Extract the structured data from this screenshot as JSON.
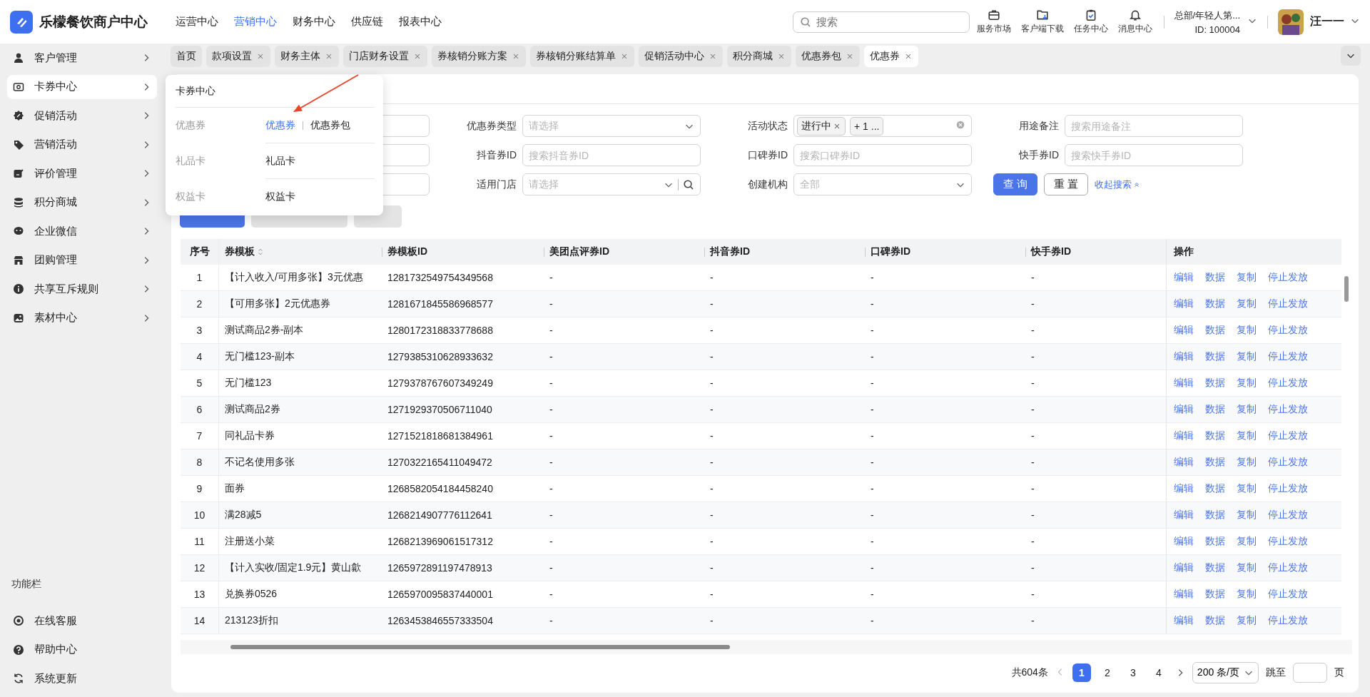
{
  "brand": {
    "name": "乐檬餐饮商户中心"
  },
  "top_nav": [
    {
      "label": "运营中心",
      "selected": false
    },
    {
      "label": "营销中心",
      "selected": true
    },
    {
      "label": "财务中心",
      "selected": false
    },
    {
      "label": "供应链",
      "selected": false
    },
    {
      "label": "报表中心",
      "selected": false
    }
  ],
  "search": {
    "placeholder": "搜索"
  },
  "header_tools": [
    {
      "label": "服务市场"
    },
    {
      "label": "客户端下载"
    },
    {
      "label": "任务中心"
    },
    {
      "label": "消息中心"
    }
  ],
  "org": {
    "name": "总部/年轻人第...",
    "id": "ID: 100004"
  },
  "user": {
    "name": "汪一一"
  },
  "sidebar": {
    "items": [
      {
        "label": "客户管理",
        "selected": false
      },
      {
        "label": "卡券中心",
        "selected": true
      },
      {
        "label": "促销活动",
        "selected": false
      },
      {
        "label": "营销活动",
        "selected": false
      },
      {
        "label": "评价管理",
        "selected": false
      },
      {
        "label": "积分商城",
        "selected": false
      },
      {
        "label": "企业微信",
        "selected": false
      },
      {
        "label": "团购管理",
        "selected": false
      },
      {
        "label": "共享互斥规则",
        "selected": false
      },
      {
        "label": "素材中心",
        "selected": false
      }
    ],
    "footer_title": "功能栏",
    "footer_items": [
      {
        "label": "在线客服"
      },
      {
        "label": "帮助中心"
      },
      {
        "label": "系统更新"
      }
    ]
  },
  "tabs": [
    {
      "label": "首页",
      "selected": false,
      "closable": false
    },
    {
      "label": "款项设置",
      "selected": false,
      "closable": true
    },
    {
      "label": "财务主体",
      "selected": false,
      "closable": true
    },
    {
      "label": "门店财务设置",
      "selected": false,
      "closable": true
    },
    {
      "label": "券核销分账方案",
      "selected": false,
      "closable": true
    },
    {
      "label": "券核销分账结算单",
      "selected": false,
      "closable": true
    },
    {
      "label": "促销活动中心",
      "selected": false,
      "closable": true
    },
    {
      "label": "积分商城",
      "selected": false,
      "closable": true
    },
    {
      "label": "优惠券包",
      "selected": false,
      "closable": true
    },
    {
      "label": "优惠券",
      "selected": true,
      "closable": true
    }
  ],
  "popup": {
    "title": "卡券中心",
    "groups": [
      {
        "category": "优惠券",
        "links": [
          {
            "label": "优惠券",
            "selected": true
          },
          {
            "label": "优惠券包",
            "selected": false
          }
        ]
      },
      {
        "category": "礼品卡",
        "links": [
          {
            "label": "礼品卡",
            "selected": false
          }
        ]
      },
      {
        "category": "权益卡",
        "links": [
          {
            "label": "权益卡",
            "selected": false
          }
        ]
      }
    ]
  },
  "filters": [
    {
      "kind": "input"
    },
    {
      "kind": "select",
      "label": "优惠券类型",
      "placeholder": "请选择"
    },
    {
      "kind": "tags",
      "label": "活动状态",
      "tags": [
        "进行中",
        "+ 1 ..."
      ]
    },
    {
      "kind": "input",
      "label": "用途备注",
      "placeholder": "搜索用途备注"
    },
    {
      "kind": "input"
    },
    {
      "kind": "input",
      "label": "抖音券ID",
      "placeholder": "搜索抖音券ID"
    },
    {
      "kind": "input",
      "label": "口碑券ID",
      "placeholder": "搜索口碑券ID"
    },
    {
      "kind": "input",
      "label": "快手券ID",
      "placeholder": "搜索快手券ID"
    },
    {
      "kind": "input"
    },
    {
      "kind": "store",
      "label": "适用门店",
      "placeholder": "请选择"
    },
    {
      "kind": "select",
      "label": "创建机构",
      "placeholder": "全部"
    }
  ],
  "filter_actions": {
    "search": "查 询",
    "reset": "重 置",
    "collapse": "收起搜索"
  },
  "toolbar_buttons": [
    {
      "kind": "primary"
    },
    {
      "kind": "default"
    },
    {
      "kind": "default"
    }
  ],
  "table": {
    "columns": [
      {
        "label": "序号",
        "sortable": false
      },
      {
        "label": "券模板",
        "sortable": true
      },
      {
        "label": "券模板ID",
        "sortable": false
      },
      {
        "label": "美团点评券ID",
        "sortable": false
      },
      {
        "label": "抖音券ID",
        "sortable": false
      },
      {
        "label": "口碑券ID",
        "sortable": false
      },
      {
        "label": "快手券ID",
        "sortable": false
      },
      {
        "label": "操作",
        "sortable": false
      }
    ],
    "rows": [
      {
        "cells": [
          "1",
          "【计入收入/可用多张】3元优惠",
          "1281732549754349568",
          "-",
          "-",
          "-",
          "-"
        ],
        "actions": [
          "编辑",
          "数据",
          "复制",
          "停止发放"
        ]
      },
      {
        "cells": [
          "2",
          "【可用多张】2元优惠券",
          "1281671845586968577",
          "-",
          "-",
          "-",
          "-"
        ],
        "actions": [
          "编辑",
          "数据",
          "复制",
          "停止发放"
        ]
      },
      {
        "cells": [
          "3",
          "测试商品2券-副本",
          "1280172318833778688",
          "-",
          "-",
          "-",
          "-"
        ],
        "actions": [
          "编辑",
          "数据",
          "复制",
          "停止发放"
        ]
      },
      {
        "cells": [
          "4",
          "无门槛123-副本",
          "1279385310628933632",
          "-",
          "-",
          "-",
          "-"
        ],
        "actions": [
          "编辑",
          "数据",
          "复制",
          "停止发放"
        ]
      },
      {
        "cells": [
          "5",
          "无门槛123",
          "1279378767607349249",
          "-",
          "-",
          "-",
          "-"
        ],
        "actions": [
          "编辑",
          "数据",
          "复制",
          "停止发放"
        ]
      },
      {
        "cells": [
          "6",
          "测试商品2券",
          "1271929370506711040",
          "-",
          "-",
          "-",
          "-"
        ],
        "actions": [
          "编辑",
          "数据",
          "复制",
          "停止发放"
        ]
      },
      {
        "cells": [
          "7",
          "同礼品卡券",
          "1271521818681384961",
          "-",
          "-",
          "-",
          "-"
        ],
        "actions": [
          "编辑",
          "数据",
          "复制",
          "停止发放"
        ]
      },
      {
        "cells": [
          "8",
          "不记名使用多张",
          "1270322165411049472",
          "-",
          "-",
          "-",
          "-"
        ],
        "actions": [
          "编辑",
          "数据",
          "复制",
          "停止发放"
        ]
      },
      {
        "cells": [
          "9",
          "面券",
          "1268582054184458240",
          "-",
          "-",
          "-",
          "-"
        ],
        "actions": [
          "编辑",
          "数据",
          "复制",
          "停止发放"
        ]
      },
      {
        "cells": [
          "10",
          "满28减5",
          "1268214907776112641",
          "-",
          "-",
          "-",
          "-"
        ],
        "actions": [
          "编辑",
          "数据",
          "复制",
          "停止发放"
        ]
      },
      {
        "cells": [
          "11",
          "注册送小菜",
          "1268213969061517312",
          "-",
          "-",
          "-",
          "-"
        ],
        "actions": [
          "编辑",
          "数据",
          "复制",
          "停止发放"
        ]
      },
      {
        "cells": [
          "12",
          "【计入实收/固定1.9元】黄山歙",
          "1265972891197478913",
          "-",
          "-",
          "-",
          "-"
        ],
        "actions": [
          "编辑",
          "数据",
          "复制",
          "停止发放"
        ]
      },
      {
        "cells": [
          "13",
          "兑换券0526",
          "1265970095837440001",
          "-",
          "-",
          "-",
          "-"
        ],
        "actions": [
          "编辑",
          "数据",
          "复制",
          "停止发放"
        ]
      },
      {
        "cells": [
          "14",
          "213123折扣",
          "1263453846557333504",
          "-",
          "-",
          "-",
          "-"
        ],
        "actions": [
          "编辑",
          "数据",
          "复制",
          "停止发放"
        ]
      }
    ]
  },
  "pagination": {
    "total": "共604条",
    "pages": [
      {
        "label": "1",
        "selected": true
      },
      {
        "label": "2",
        "selected": false
      },
      {
        "label": "3",
        "selected": false
      },
      {
        "label": "4",
        "selected": false
      }
    ],
    "page_size": "200 条/页",
    "jump_label": "跳至",
    "page_unit": "页"
  }
}
